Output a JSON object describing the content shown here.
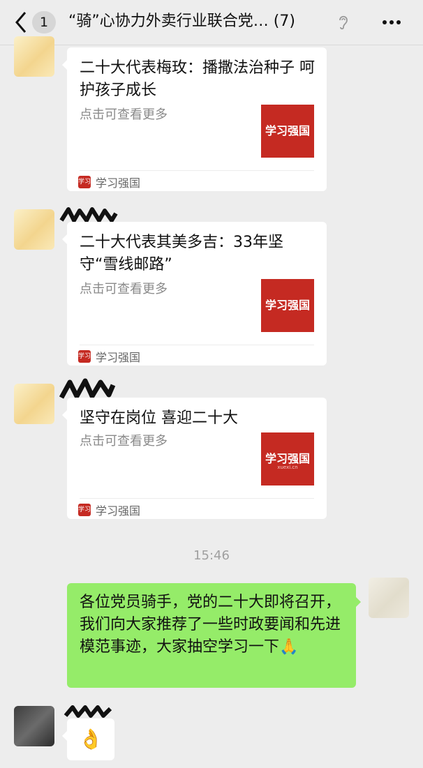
{
  "header": {
    "unread_count": "1",
    "title": "“骑”心协力外卖行业联合党…",
    "member_count": "(7)",
    "back_icon": "chevron-left-icon",
    "mute_icon": "ear-icon",
    "more_icon": "ellipsis-icon"
  },
  "messages": [
    {
      "type": "link-card",
      "title": "二十大代表梅玫：播撒法治种子 呵护孩子成长",
      "desc": "点击可查看更多",
      "thumb_text": "学习强国",
      "source": "学习强国",
      "source_icon_text": "学习"
    },
    {
      "type": "link-card",
      "title": "二十大代表其美多吉：33年坚守“雪线邮路”",
      "desc": "点击可查看更多",
      "thumb_text": "学习强国",
      "source": "学习强国",
      "source_icon_text": "学习"
    },
    {
      "type": "link-card",
      "title": "坚守在岗位 喜迎二十大",
      "desc": "点击可查看更多",
      "thumb_text": "学习强国",
      "thumb_sub": "xuexi.cn",
      "source": "学习强国",
      "source_icon_text": "学习"
    }
  ],
  "timestamp": "15:46",
  "my_message": {
    "text": "各位党员骑手，党的二十大即将召开，我们向大家推荐了一些时政要闻和先进模范事迹，大家抽空学习一下",
    "emoji": "🙏"
  },
  "reply": {
    "emoji": "👌"
  },
  "colors": {
    "background": "#ededed",
    "self_bubble": "#95ec69",
    "card": "#ffffff",
    "brand_red": "#c52a22"
  }
}
